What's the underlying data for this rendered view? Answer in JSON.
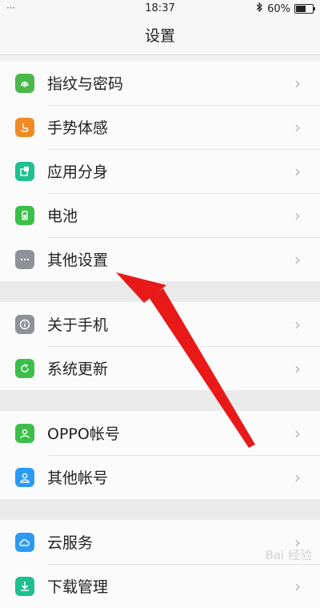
{
  "status": {
    "time": "18:37",
    "battery_percent": "60%",
    "battery_level": 0.6,
    "left_dots": "⋯"
  },
  "header": {
    "title": "设置"
  },
  "groups": [
    {
      "items": [
        {
          "label": "指纹与密码",
          "icon": "fingerprint-icon",
          "color": "#4cb84c"
        },
        {
          "label": "手势体感",
          "icon": "hand-gesture-icon",
          "color": "#f08a24"
        },
        {
          "label": "应用分身",
          "icon": "app-clone-icon",
          "color": "#1fbf8f"
        },
        {
          "label": "电池",
          "icon": "battery-icon",
          "color": "#3cbf4a"
        },
        {
          "label": "其他设置",
          "icon": "more-dots-icon",
          "color": "#8e9198"
        }
      ]
    },
    {
      "items": [
        {
          "label": "关于手机",
          "icon": "info-icon",
          "color": "#8e9198"
        },
        {
          "label": "系统更新",
          "icon": "system-update-icon",
          "color": "#3cbf4a"
        }
      ]
    },
    {
      "items": [
        {
          "label": "OPPO帐号",
          "icon": "oppo-account-icon",
          "color": "#3cbf4a"
        },
        {
          "label": "其他帐号",
          "icon": "other-accounts-icon",
          "color": "#2b9af3"
        }
      ]
    },
    {
      "items": [
        {
          "label": "云服务",
          "icon": "cloud-icon",
          "color": "#2b9af3"
        },
        {
          "label": "下载管理",
          "icon": "download-icon",
          "color": "#1fbf8f"
        }
      ]
    }
  ],
  "chevron": "›",
  "watermark": "Bai 经验"
}
